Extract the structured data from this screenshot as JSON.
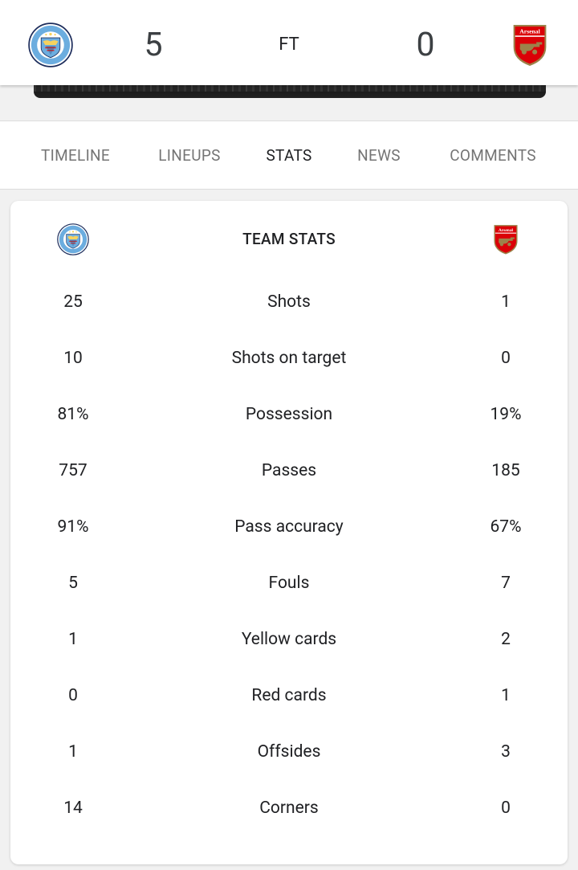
{
  "match": {
    "home_team": "Manchester City",
    "home_crest_text": "MANCHESTER CITY",
    "home_score": "5",
    "status": "FT",
    "away_score": "0",
    "away_team": "Arsenal",
    "away_crest_text": "Arsenal"
  },
  "tabs": [
    {
      "label": "TIMELINE",
      "active": false
    },
    {
      "label": "LINEUPS",
      "active": false
    },
    {
      "label": "STATS",
      "active": true
    },
    {
      "label": "NEWS",
      "active": false
    },
    {
      "label": "COMMENTS",
      "active": false
    }
  ],
  "team_stats": {
    "title": "TEAM STATS",
    "rows": [
      {
        "label": "Shots",
        "home": "25",
        "away": "1"
      },
      {
        "label": "Shots on target",
        "home": "10",
        "away": "0"
      },
      {
        "label": "Possession",
        "home": "81%",
        "away": "19%"
      },
      {
        "label": "Passes",
        "home": "757",
        "away": "185"
      },
      {
        "label": "Pass accuracy",
        "home": "91%",
        "away": "67%"
      },
      {
        "label": "Fouls",
        "home": "5",
        "away": "7"
      },
      {
        "label": "Yellow cards",
        "home": "1",
        "away": "2"
      },
      {
        "label": "Red cards",
        "home": "0",
        "away": "1"
      },
      {
        "label": "Offsides",
        "home": "1",
        "away": "3"
      },
      {
        "label": "Corners",
        "home": "14",
        "away": "0"
      }
    ]
  },
  "colors": {
    "city_blue": "#6caddf",
    "city_navy": "#1c2c5b",
    "arsenal_red": "#db0007",
    "arsenal_gold": "#9c824a",
    "tab_active": "#202124",
    "tab_inactive": "#757575"
  },
  "icons": {
    "home_crest": "manchester-city-crest-icon",
    "away_crest": "arsenal-crest-icon"
  }
}
